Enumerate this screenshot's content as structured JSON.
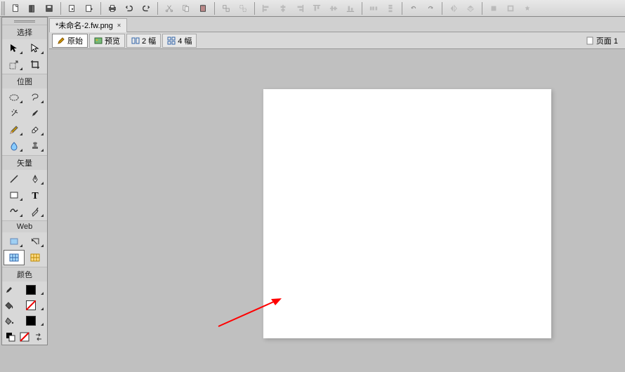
{
  "file": {
    "tab_name": "*未命名-2.fw.png"
  },
  "view_modes": {
    "original": "原始",
    "preview": "预览",
    "two_up": "2 幅",
    "four_up": "4 幅"
  },
  "page": {
    "label": "页面 1"
  },
  "tool_sections": {
    "select": "选择",
    "bitmap": "位图",
    "vector": "矢量",
    "web": "Web",
    "colors": "颜色"
  },
  "colors": {
    "stroke": "#000000",
    "fill_is_none": true,
    "fill": "#ffffff",
    "extra": "#000000"
  }
}
